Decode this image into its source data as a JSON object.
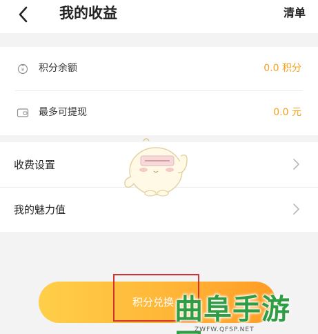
{
  "header": {
    "title": "我的收益",
    "right_action": "清单"
  },
  "balance": {
    "points": {
      "label": "积分余额",
      "value": "0.0 积分",
      "icon": "coin-icon"
    },
    "withdrawable": {
      "label": "最多可提现",
      "value": "0.0 元",
      "icon": "wallet-icon"
    }
  },
  "menu": {
    "items": [
      {
        "label": "收费设置",
        "icon": "chevron-right-icon"
      },
      {
        "label": "我的魅力值",
        "icon": "chevron-right-icon"
      }
    ]
  },
  "actions": {
    "exchange_label": "积分兑换"
  },
  "watermark": {
    "logo": "曲阜手游网",
    "url": "ZWFW.QFSP.NET"
  },
  "colors": {
    "accent": "#f5a11a",
    "button_gradient": [
      "#ffcf4a",
      "#ff9b25"
    ],
    "highlight": "#d23232",
    "watermark": "#2f9d44"
  }
}
